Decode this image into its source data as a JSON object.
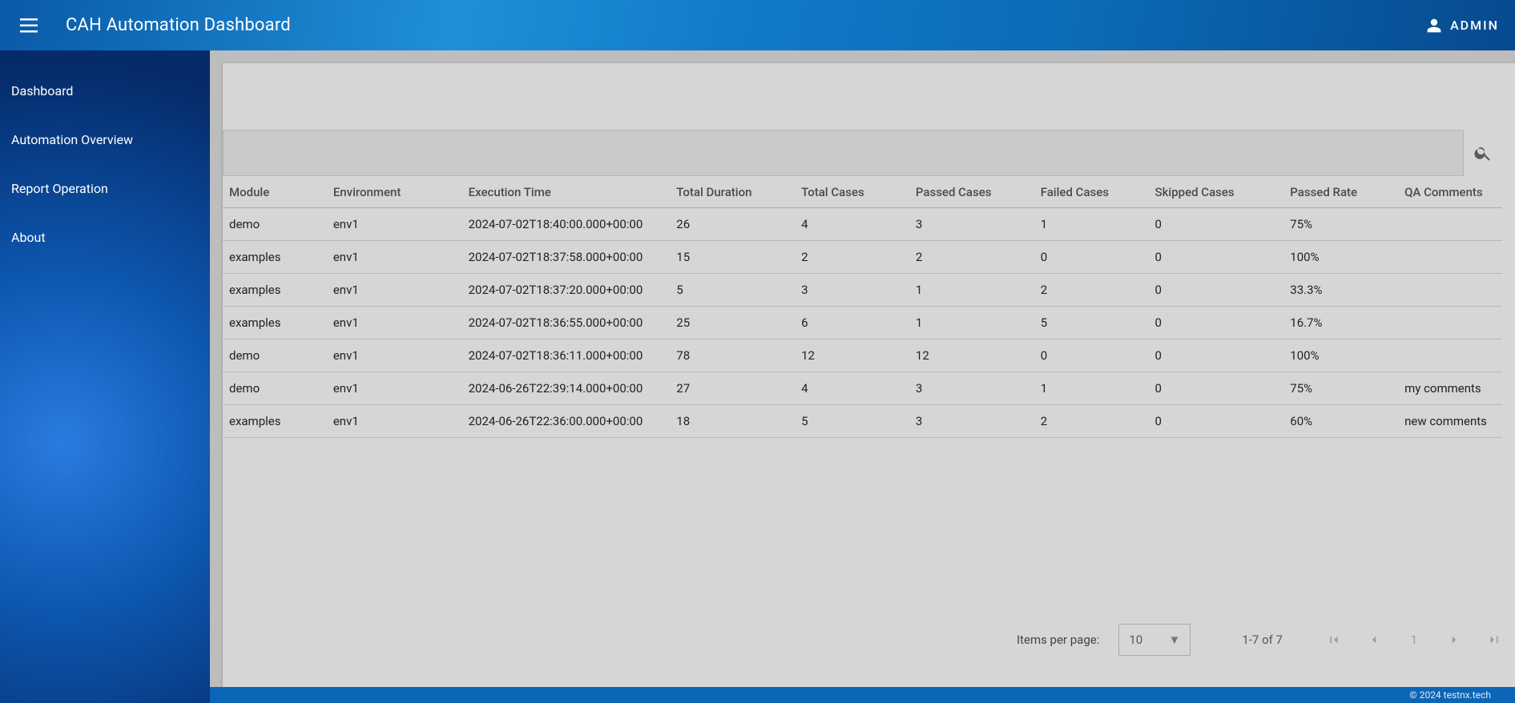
{
  "appbar": {
    "title": "CAH Automation Dashboard",
    "user_label": "ADMIN"
  },
  "sidebar": {
    "items": [
      {
        "label": "Dashboard"
      },
      {
        "label": "Automation Overview"
      },
      {
        "label": "Report Operation"
      },
      {
        "label": "About"
      }
    ]
  },
  "table": {
    "headers": {
      "module": "Module",
      "environment": "Environment",
      "execution_time": "Execution Time",
      "total_duration": "Total Duration",
      "total_cases": "Total Cases",
      "passed_cases": "Passed Cases",
      "failed_cases": "Failed Cases",
      "skipped_cases": "Skipped Cases",
      "passed_rate": "Passed Rate",
      "qa_comments": "QA Comments"
    },
    "rows": [
      {
        "module": "demo",
        "env": "env1",
        "exec": "2024-07-02T18:40:00.000+00:00",
        "dur": "26",
        "total": "4",
        "pass": "3",
        "fail": "1",
        "skip": "0",
        "rate": "75%",
        "comments": ""
      },
      {
        "module": "examples",
        "env": "env1",
        "exec": "2024-07-02T18:37:58.000+00:00",
        "dur": "15",
        "total": "2",
        "pass": "2",
        "fail": "0",
        "skip": "0",
        "rate": "100%",
        "comments": ""
      },
      {
        "module": "examples",
        "env": "env1",
        "exec": "2024-07-02T18:37:20.000+00:00",
        "dur": "5",
        "total": "3",
        "pass": "1",
        "fail": "2",
        "skip": "0",
        "rate": "33.3%",
        "comments": ""
      },
      {
        "module": "examples",
        "env": "env1",
        "exec": "2024-07-02T18:36:55.000+00:00",
        "dur": "25",
        "total": "6",
        "pass": "1",
        "fail": "5",
        "skip": "0",
        "rate": "16.7%",
        "comments": ""
      },
      {
        "module": "demo",
        "env": "env1",
        "exec": "2024-07-02T18:36:11.000+00:00",
        "dur": "78",
        "total": "12",
        "pass": "12",
        "fail": "0",
        "skip": "0",
        "rate": "100%",
        "comments": ""
      },
      {
        "module": "demo",
        "env": "env1",
        "exec": "2024-06-26T22:39:14.000+00:00",
        "dur": "27",
        "total": "4",
        "pass": "3",
        "fail": "1",
        "skip": "0",
        "rate": "75%",
        "comments": "my comments"
      },
      {
        "module": "examples",
        "env": "env1",
        "exec": "2024-06-26T22:36:00.000+00:00",
        "dur": "18",
        "total": "5",
        "pass": "3",
        "fail": "2",
        "skip": "0",
        "rate": "60%",
        "comments": "new comments"
      }
    ]
  },
  "pagination": {
    "items_label": "Items per page:",
    "page_size": "10",
    "range": "1-7 of 7",
    "current_page": "1"
  },
  "footer": {
    "copyright": "© 2024 testnx.tech"
  }
}
